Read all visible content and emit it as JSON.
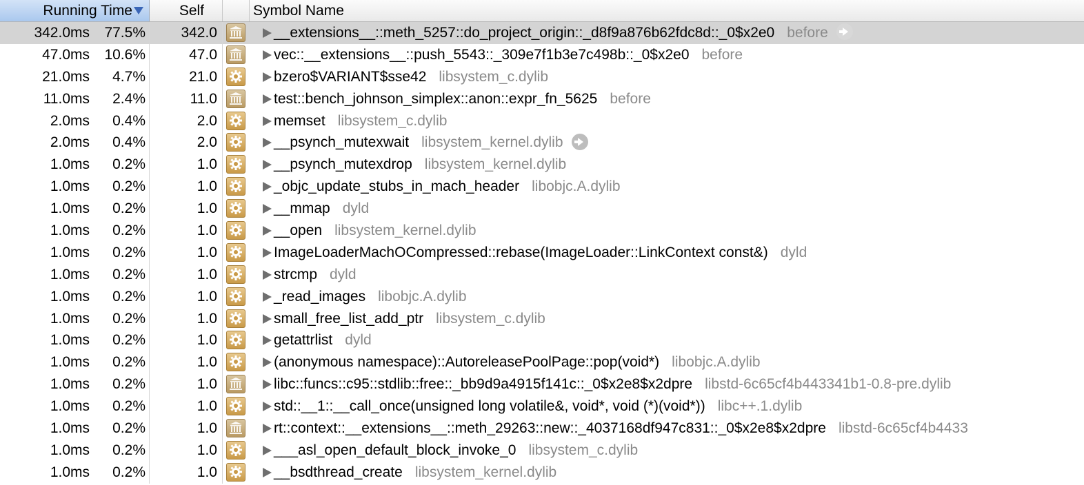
{
  "header": {
    "running_time": "Running Time",
    "self": "Self",
    "symbol_name": "Symbol Name"
  },
  "colors": {
    "selected_row": "#d4d4d4",
    "library_text": "#8a8a8a",
    "sort_header": "#aac8ee"
  },
  "rows": [
    {
      "ms": "342.0ms",
      "pct": "77.5%",
      "self": "342.0",
      "icon": "library-icon",
      "name": "__extensions__::meth_5257::do_project_origin::_d8f9a876b62fdc8d::_0$x2e0",
      "lib": "before",
      "goto": true,
      "selected": true
    },
    {
      "ms": "47.0ms",
      "pct": "10.6%",
      "self": "47.0",
      "icon": "library-icon",
      "name": "vec::__extensions__::push_5543::_309e7f1b3e7c498b::_0$x2e0",
      "lib": "before",
      "goto": false,
      "selected": false
    },
    {
      "ms": "21.0ms",
      "pct": "4.7%",
      "self": "21.0",
      "icon": "system-gear-icon",
      "name": "bzero$VARIANT$sse42",
      "lib": "libsystem_c.dylib",
      "goto": false,
      "selected": false
    },
    {
      "ms": "11.0ms",
      "pct": "2.4%",
      "self": "11.0",
      "icon": "library-icon",
      "name": "test::bench_johnson_simplex::anon::expr_fn_5625",
      "lib": "before",
      "goto": false,
      "selected": false
    },
    {
      "ms": "2.0ms",
      "pct": "0.4%",
      "self": "2.0",
      "icon": "system-gear-icon",
      "name": "memset",
      "lib": "libsystem_c.dylib",
      "goto": false,
      "selected": false
    },
    {
      "ms": "2.0ms",
      "pct": "0.4%",
      "self": "2.0",
      "icon": "system-gear-icon",
      "name": "__psynch_mutexwait",
      "lib": "libsystem_kernel.dylib",
      "goto": true,
      "selected": false
    },
    {
      "ms": "1.0ms",
      "pct": "0.2%",
      "self": "1.0",
      "icon": "system-gear-icon",
      "name": "__psynch_mutexdrop",
      "lib": "libsystem_kernel.dylib",
      "goto": false,
      "selected": false
    },
    {
      "ms": "1.0ms",
      "pct": "0.2%",
      "self": "1.0",
      "icon": "system-gear-icon",
      "name": "_objc_update_stubs_in_mach_header",
      "lib": "libobjc.A.dylib",
      "goto": false,
      "selected": false
    },
    {
      "ms": "1.0ms",
      "pct": "0.2%",
      "self": "1.0",
      "icon": "system-gear-icon",
      "name": "__mmap",
      "lib": "dyld",
      "goto": false,
      "selected": false
    },
    {
      "ms": "1.0ms",
      "pct": "0.2%",
      "self": "1.0",
      "icon": "system-gear-icon",
      "name": "__open",
      "lib": "libsystem_kernel.dylib",
      "goto": false,
      "selected": false
    },
    {
      "ms": "1.0ms",
      "pct": "0.2%",
      "self": "1.0",
      "icon": "system-gear-icon",
      "name": "ImageLoaderMachOCompressed::rebase(ImageLoader::LinkContext const&)",
      "lib": "dyld",
      "goto": false,
      "selected": false
    },
    {
      "ms": "1.0ms",
      "pct": "0.2%",
      "self": "1.0",
      "icon": "system-gear-icon",
      "name": "strcmp",
      "lib": "dyld",
      "goto": false,
      "selected": false
    },
    {
      "ms": "1.0ms",
      "pct": "0.2%",
      "self": "1.0",
      "icon": "system-gear-icon",
      "name": "_read_images",
      "lib": "libobjc.A.dylib",
      "goto": false,
      "selected": false
    },
    {
      "ms": "1.0ms",
      "pct": "0.2%",
      "self": "1.0",
      "icon": "system-gear-icon",
      "name": "small_free_list_add_ptr",
      "lib": "libsystem_c.dylib",
      "goto": false,
      "selected": false
    },
    {
      "ms": "1.0ms",
      "pct": "0.2%",
      "self": "1.0",
      "icon": "system-gear-icon",
      "name": "getattrlist",
      "lib": "dyld",
      "goto": false,
      "selected": false
    },
    {
      "ms": "1.0ms",
      "pct": "0.2%",
      "self": "1.0",
      "icon": "system-gear-icon",
      "name": "(anonymous namespace)::AutoreleasePoolPage::pop(void*)",
      "lib": "libobjc.A.dylib",
      "goto": false,
      "selected": false
    },
    {
      "ms": "1.0ms",
      "pct": "0.2%",
      "self": "1.0",
      "icon": "library-icon",
      "name": "libc::funcs::c95::stdlib::free::_bb9d9a4915f141c::_0$x2e8$x2dpre",
      "lib": "libstd-6c65cf4b443341b1-0.8-pre.dylib",
      "goto": false,
      "selected": false
    },
    {
      "ms": "1.0ms",
      "pct": "0.2%",
      "self": "1.0",
      "icon": "system-gear-icon",
      "name": "std::__1::__call_once(unsigned long volatile&, void*, void (*)(void*))",
      "lib": "libc++.1.dylib",
      "goto": false,
      "selected": false
    },
    {
      "ms": "1.0ms",
      "pct": "0.2%",
      "self": "1.0",
      "icon": "library-icon",
      "name": "rt::context::__extensions__::meth_29263::new::_4037168df947c831::_0$x2e8$x2dpre",
      "lib": "libstd-6c65cf4b4433",
      "goto": false,
      "selected": false
    },
    {
      "ms": "1.0ms",
      "pct": "0.2%",
      "self": "1.0",
      "icon": "system-gear-icon",
      "name": "___asl_open_default_block_invoke_0",
      "lib": "libsystem_c.dylib",
      "goto": false,
      "selected": false
    },
    {
      "ms": "1.0ms",
      "pct": "0.2%",
      "self": "1.0",
      "icon": "system-gear-icon",
      "name": "__bsdthread_create",
      "lib": "libsystem_kernel.dylib",
      "goto": false,
      "selected": false
    }
  ]
}
